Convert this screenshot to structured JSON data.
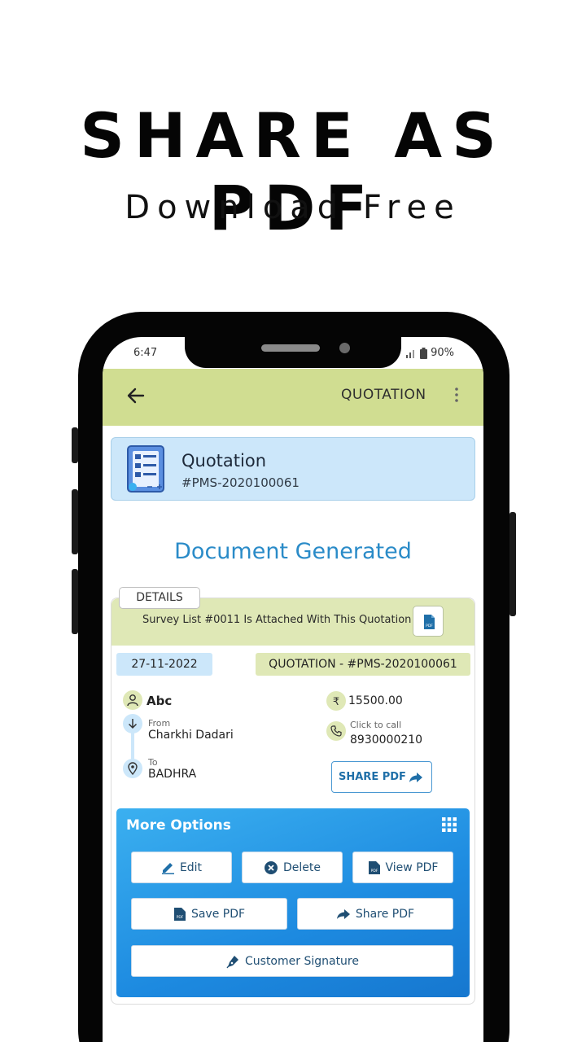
{
  "hero": {
    "title": "SHARE AS PDF",
    "subtitle": "Download Free"
  },
  "status_bar": {
    "time": "6:47",
    "battery": "90%"
  },
  "app_bar": {
    "title": "QUOTATION"
  },
  "quotation_card": {
    "title": "Quotation",
    "id": "#PMS-2020100061"
  },
  "document_generated": "Document Generated",
  "details": {
    "tab_label": "DETAILS",
    "survey_text": "Survey List #0011 Is Attached With This Quotation",
    "date": "27-11-2022",
    "quotation_number": "QUOTATION - #PMS-2020100061",
    "customer_name": "Abc",
    "amount": "15500.00",
    "from_label": "From",
    "from_city": "Charkhi Dadari",
    "to_label": "To",
    "to_city": "BADHRA",
    "call_label": "Click to call",
    "phone": "8930000210",
    "share_pdf_label": "SHARE PDF"
  },
  "more_options": {
    "title": "More Options",
    "buttons": {
      "edit": "Edit",
      "delete": "Delete",
      "view_pdf": "View PDF",
      "save_pdf": "Save PDF",
      "share_pdf": "Share PDF",
      "customer_signature": "Customer Signature"
    }
  },
  "colors": {
    "appbar": "#d0dd91",
    "accent_blue": "#2a8bc8",
    "light_blue": "#cce7fa",
    "light_green": "#dfe8b6",
    "more_options_blue": "#1d8ae0"
  },
  "icons": [
    "back-arrow-icon",
    "more-vert-icon",
    "quotation-list-icon",
    "pdf-file-icon",
    "person-icon",
    "arrow-down-icon",
    "location-pin-icon",
    "rupee-icon",
    "phone-icon",
    "share-arrow-icon",
    "grid-icon",
    "pencil-icon",
    "close-circle-icon",
    "pen-nib-icon",
    "signal-icon",
    "battery-icon"
  ]
}
